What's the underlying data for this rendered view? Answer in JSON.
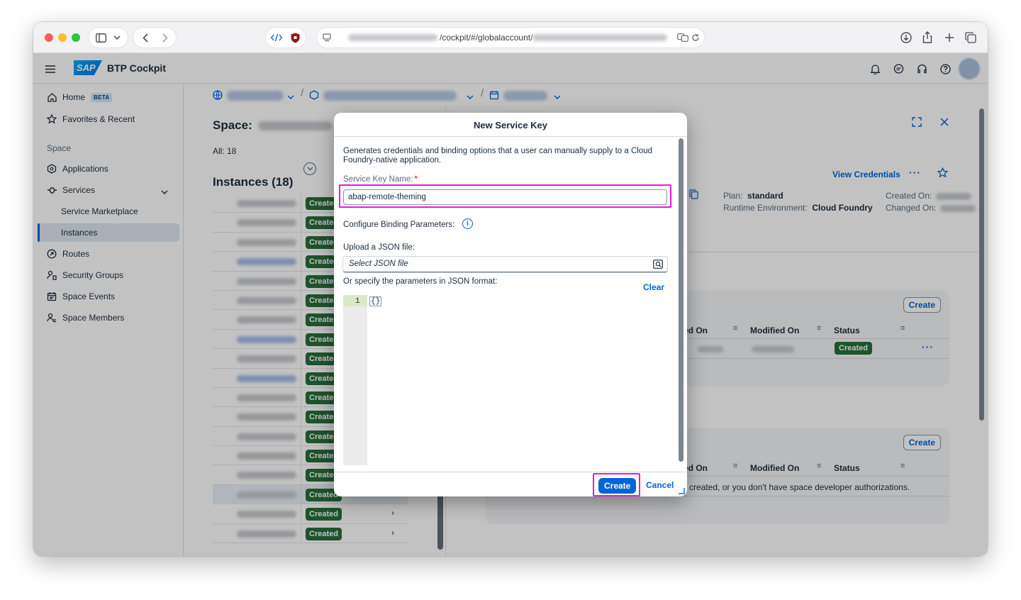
{
  "browser": {
    "url_visible": "/cockpit/#/globalaccount/"
  },
  "shell": {
    "logo": "SAP",
    "title": "BTP Cockpit"
  },
  "nav": {
    "home": "Home",
    "home_badge": "BETA",
    "favorites": "Favorites & Recent",
    "group": "Space",
    "applications": "Applications",
    "services": "Services",
    "service_marketplace": "Service Marketplace",
    "instances": "Instances",
    "routes": "Routes",
    "security_groups": "Security Groups",
    "space_events": "Space Events",
    "space_members": "Space Members"
  },
  "page": {
    "space_label": "Space:",
    "all_count": "All: 18",
    "instances_heading": "Instances (18)",
    "status_created": "Created"
  },
  "detail": {
    "view_credentials": "View Credentials",
    "plan_label": "Plan:",
    "plan_value": "standard",
    "runtime_label": "Runtime Environment:",
    "runtime_value": "Cloud Foundry",
    "created_on_label": "Created On:",
    "changed_on_label": "Changed On:",
    "card1": {
      "create": "Create",
      "col_created": "ed On",
      "col_modified": "Modified On",
      "col_status": "Status",
      "row_status": "Created"
    },
    "card2": {
      "create": "Create",
      "col_created": "ed On",
      "col_modified": "Modified On",
      "col_status": "Status",
      "empty_text": "created, or you don't have space developer authorizations."
    }
  },
  "dialog": {
    "title": "New Service Key",
    "description": "Generates credentials and binding options that a user can manually supply to a Cloud Foundry-native application.",
    "key_name_label": "Service Key Name:",
    "key_name_value": "abap-remote-theming",
    "configure_label": "Configure Binding Parameters:",
    "upload_label": "Upload a JSON file:",
    "file_placeholder": "Select JSON file",
    "json_label": "Or specify the parameters in JSON format:",
    "clear": "Clear",
    "editor_line": "1",
    "editor_code": "{}",
    "create": "Create",
    "cancel": "Cancel"
  }
}
